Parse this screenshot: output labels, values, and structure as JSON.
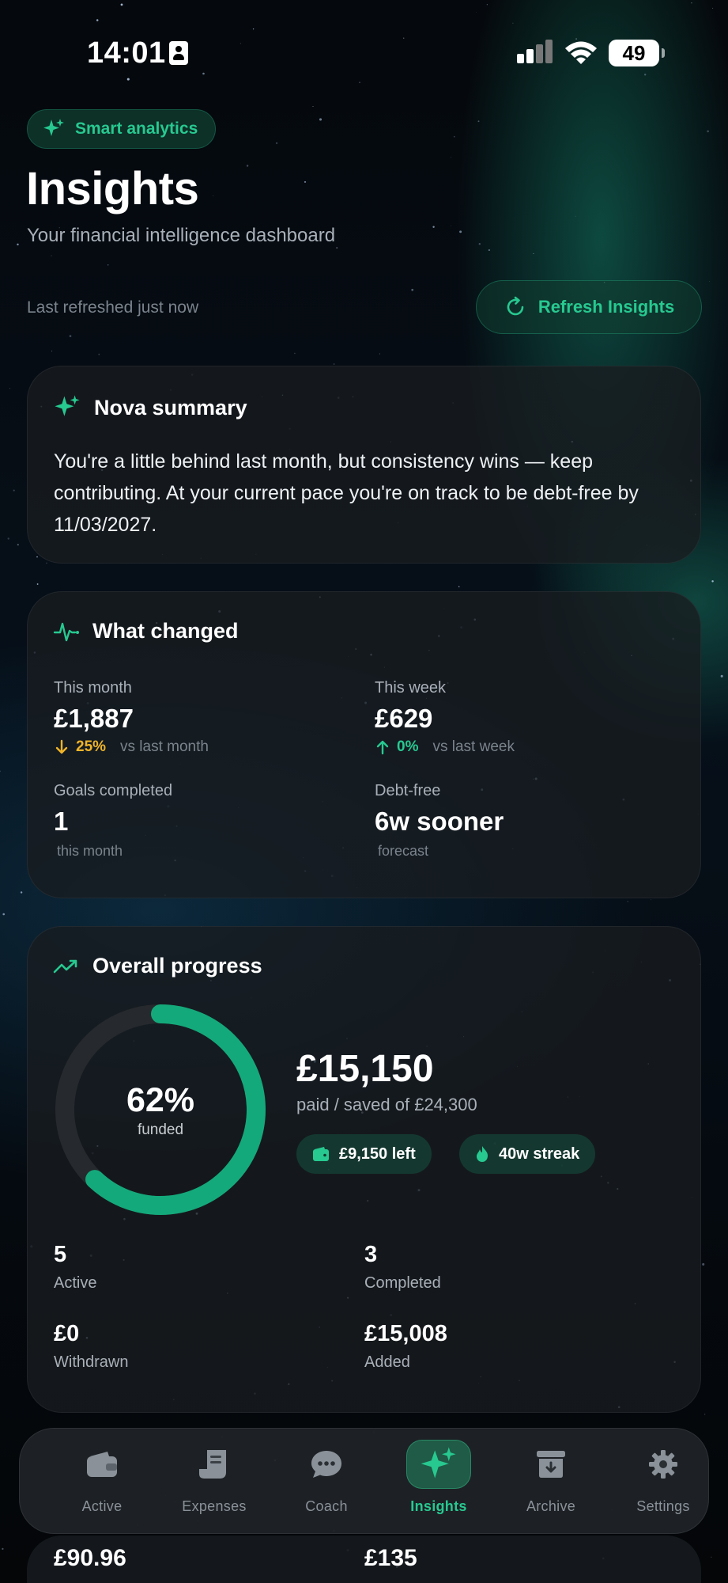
{
  "status_bar": {
    "time": "14:01",
    "battery": "49"
  },
  "header": {
    "badge": "Smart analytics",
    "title": "Insights",
    "subtitle": "Your financial intelligence dashboard",
    "last_refreshed": "Last refreshed just now",
    "refresh_button": "Refresh Insights"
  },
  "nova": {
    "title": "Nova summary",
    "text": "You're a little behind last month, but consistency wins — keep contributing. At your current pace you're on track to be debt-free by 11/03/2027."
  },
  "changed": {
    "title": "What changed",
    "this_month": {
      "label": "This month",
      "value": "£1,887",
      "delta": "25%",
      "delta_dir": "down",
      "vs": "vs last month"
    },
    "this_week": {
      "label": "This week",
      "value": "£629",
      "delta": "0%",
      "delta_dir": "up",
      "vs": "vs last week"
    },
    "goals": {
      "label": "Goals completed",
      "value": "1",
      "sub": "this month"
    },
    "debt_free": {
      "label": "Debt-free",
      "value": "6w sooner",
      "sub": "forecast"
    }
  },
  "progress": {
    "title": "Overall progress",
    "percent_label": "62%",
    "percent_value": 0.62,
    "funded_label": "funded",
    "amount": "£15,150",
    "amount_sub": "paid / saved of £24,300",
    "chip_left": "£9,150 left",
    "chip_streak": "40w streak",
    "stats": [
      {
        "value": "5",
        "label": "Active"
      },
      {
        "value": "3",
        "label": "Completed"
      },
      {
        "value": "£0",
        "label": "Withdrawn"
      },
      {
        "value": "£15,008",
        "label": "Added"
      }
    ]
  },
  "peek": {
    "left": "£90.96",
    "right": "£135"
  },
  "tabs": [
    {
      "label": "Active",
      "icon": "wallet-icon",
      "active": false
    },
    {
      "label": "Expenses",
      "icon": "receipt-icon",
      "active": false
    },
    {
      "label": "Coach",
      "icon": "chat-bubble-icon",
      "active": false
    },
    {
      "label": "Insights",
      "icon": "sparkles-icon",
      "active": true
    },
    {
      "label": "Archive",
      "icon": "archive-icon",
      "active": false
    },
    {
      "label": "Settings",
      "icon": "gear-icon",
      "active": false
    }
  ],
  "colors": {
    "accent": "#27c990",
    "ring_track": "#26292d",
    "ring_fill": "#14a97a",
    "warning": "#f0b429"
  }
}
